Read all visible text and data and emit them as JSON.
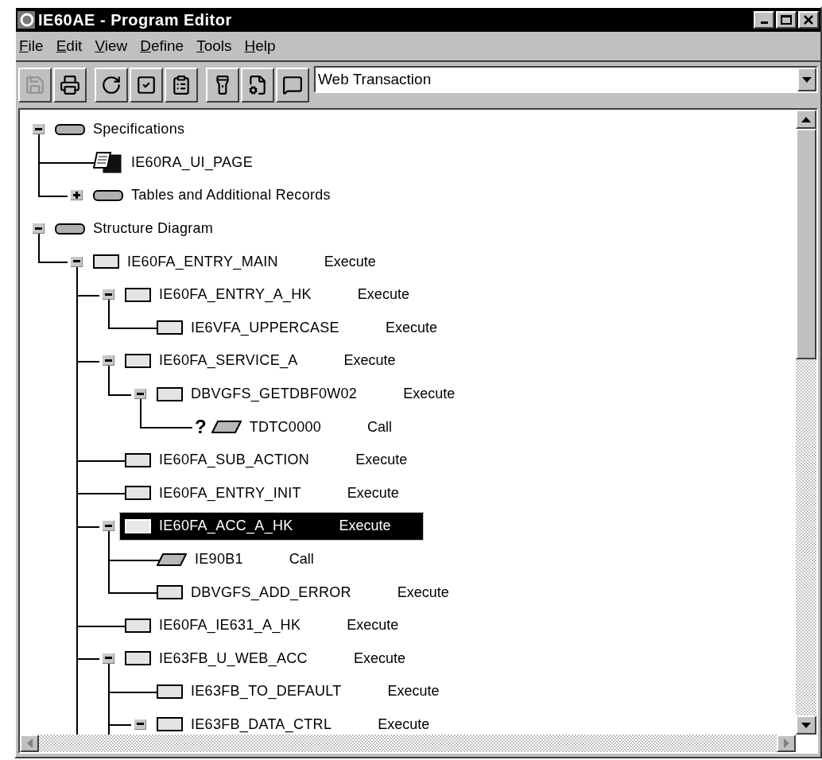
{
  "window": {
    "title": "IE60AE - Program Editor"
  },
  "menu": [
    "File",
    "Edit",
    "View",
    "Define",
    "Tools",
    "Help"
  ],
  "toolbar": [
    {
      "kind": "save",
      "disabled": true
    },
    {
      "kind": "print",
      "disabled": false
    },
    {
      "kind": "refresh",
      "disabled": false
    },
    {
      "kind": "check",
      "disabled": false
    },
    {
      "kind": "clipboard",
      "disabled": false
    },
    {
      "kind": "flashlight",
      "disabled": false
    },
    {
      "kind": "properties",
      "disabled": false
    },
    {
      "kind": "comment",
      "disabled": false
    }
  ],
  "type_select": {
    "value": "Web Transaction"
  },
  "tree": [
    {
      "name": "Specifications",
      "kind": "category",
      "expanded": true,
      "selected": false,
      "children": [
        {
          "name": "IE60RA_UI_PAGE",
          "kind": "page",
          "selected": false
        },
        {
          "name": "Tables and Additional Records",
          "kind": "category",
          "expanded": false,
          "selected": false
        }
      ]
    },
    {
      "name": "Structure Diagram",
      "kind": "category",
      "expanded": true,
      "selected": false,
      "children": [
        {
          "name": "IE60FA_ENTRY_MAIN",
          "action": "Execute",
          "kind": "process",
          "expanded": true,
          "selected": false,
          "more_below": true,
          "children": [
            {
              "name": "IE60FA_ENTRY_A_HK",
              "action": "Execute",
              "kind": "process",
              "expanded": true,
              "selected": false,
              "children": [
                {
                  "name": "IE6VFA_UPPERCASE",
                  "action": "Execute",
                  "kind": "process",
                  "selected": false
                }
              ]
            },
            {
              "name": "IE60FA_SERVICE_A",
              "action": "Execute",
              "kind": "process",
              "expanded": true,
              "selected": false,
              "children": [
                {
                  "name": "DBVGFS_GETDBF0W02",
                  "action": "Execute",
                  "kind": "process",
                  "expanded": true,
                  "selected": false,
                  "children": [
                    {
                      "name": "TDTC0000",
                      "action": "Call",
                      "kind": "call",
                      "unresolved": true,
                      "marker": "?",
                      "selected": false
                    }
                  ]
                }
              ]
            },
            {
              "name": "IE60FA_SUB_ACTION",
              "action": "Execute",
              "kind": "process",
              "selected": false
            },
            {
              "name": "IE60FA_ENTRY_INIT",
              "action": "Execute",
              "kind": "process",
              "selected": false
            },
            {
              "name": "IE60FA_ACC_A_HK",
              "action": "Execute",
              "kind": "process",
              "expanded": true,
              "selected": true,
              "children": [
                {
                  "name": "IE90B1",
                  "action": "Call",
                  "kind": "call",
                  "selected": false
                },
                {
                  "name": "DBVGFS_ADD_ERROR",
                  "action": "Execute",
                  "kind": "process",
                  "selected": false
                }
              ]
            },
            {
              "name": "IE60FA_IE631_A_HK",
              "action": "Execute",
              "kind": "process",
              "selected": false
            },
            {
              "name": "IE63FB_U_WEB_ACC",
              "action": "Execute",
              "kind": "process",
              "expanded": true,
              "selected": false,
              "more_below": true,
              "children": [
                {
                  "name": "IE63FB_TO_DEFAULT",
                  "action": "Execute",
                  "kind": "process",
                  "selected": false
                },
                {
                  "name": "IE63FB_DATA_CTRL",
                  "action": "Execute",
                  "kind": "process",
                  "expanded": true,
                  "selected": false
                }
              ]
            }
          ]
        }
      ]
    }
  ]
}
